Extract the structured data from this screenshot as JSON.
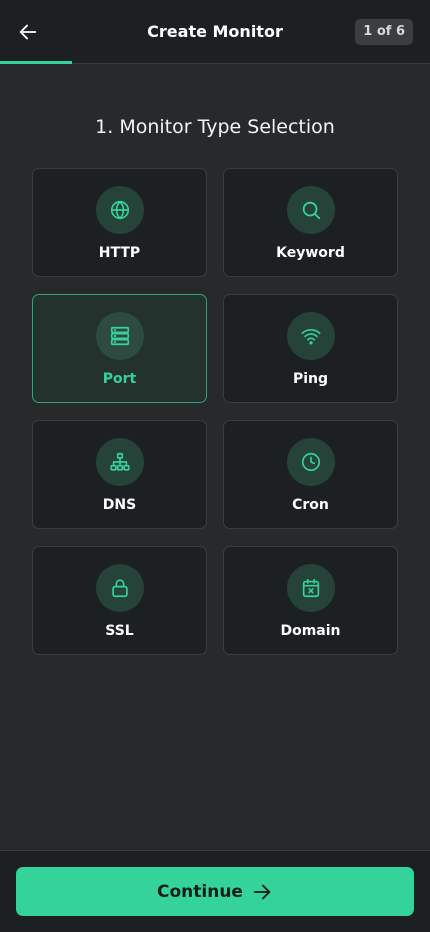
{
  "header": {
    "title": "Create Monitor",
    "step": "1 of 6",
    "progress_fraction": 0.1667,
    "back_icon": "arrow-left-icon"
  },
  "section": {
    "title": "1. Monitor Type Selection"
  },
  "monitor_types": [
    {
      "label": "HTTP",
      "icon": "globe-icon",
      "selected": false
    },
    {
      "label": "Keyword",
      "icon": "search-icon",
      "selected": false
    },
    {
      "label": "Port",
      "icon": "server-icon",
      "selected": true
    },
    {
      "label": "Ping",
      "icon": "wifi-icon",
      "selected": false
    },
    {
      "label": "DNS",
      "icon": "network-icon",
      "selected": false
    },
    {
      "label": "Cron",
      "icon": "clock-icon",
      "selected": false
    },
    {
      "label": "SSL",
      "icon": "lock-icon",
      "selected": false
    },
    {
      "label": "Domain",
      "icon": "calendar-x-icon",
      "selected": false
    }
  ],
  "footer": {
    "continue_label": "Continue",
    "continue_icon": "arrow-right-icon"
  },
  "colors": {
    "accent": "#34d399",
    "background": "#28292b",
    "surface": "#1d2022",
    "border": "#3a3d40"
  }
}
